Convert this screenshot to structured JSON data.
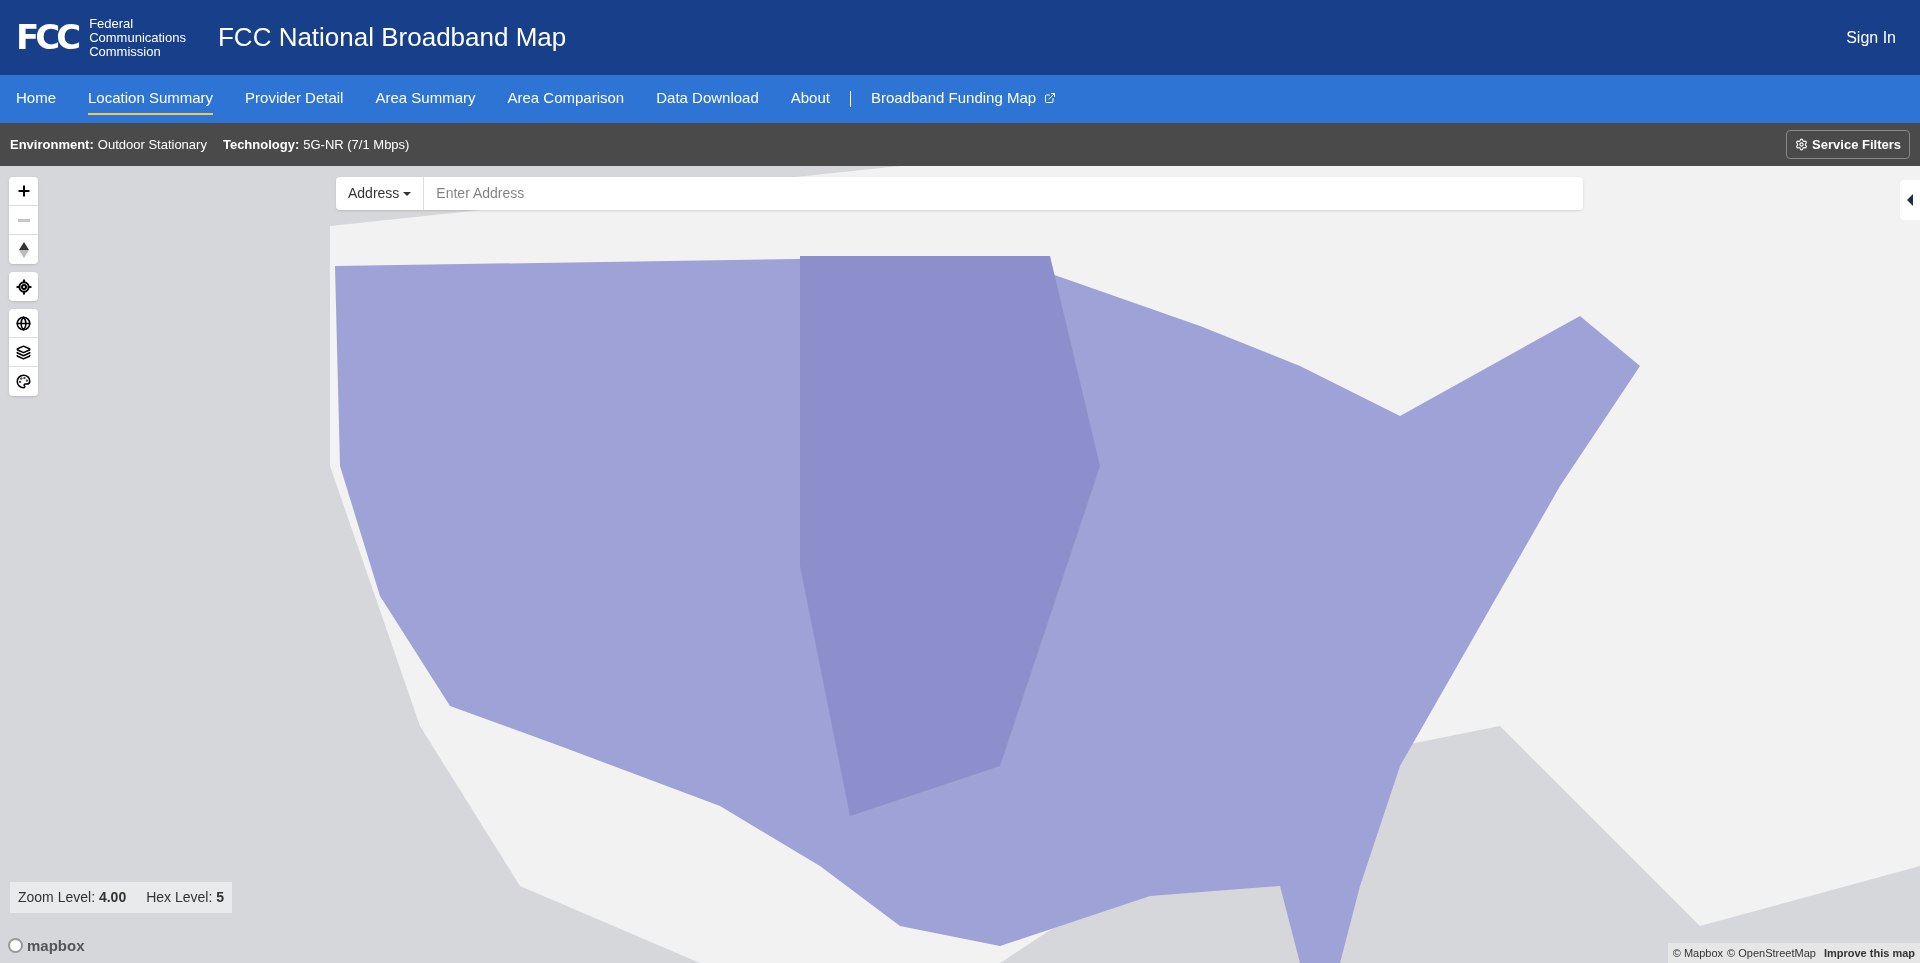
{
  "header": {
    "logo_mark": "FCC",
    "agency": [
      "Federal",
      "Communications",
      "Commission"
    ],
    "title": "FCC National Broadband Map",
    "sign_in": "Sign In"
  },
  "nav": [
    {
      "label": "Home",
      "selected": false
    },
    {
      "label": "Location Summary",
      "selected": true
    },
    {
      "label": "Provider Detail",
      "selected": false
    },
    {
      "label": "Area Summary",
      "selected": false
    },
    {
      "label": "Area Comparison",
      "selected": false
    },
    {
      "label": "Data Download",
      "selected": false
    },
    {
      "label": "About",
      "selected": false
    }
  ],
  "external_links": [
    {
      "label": "Broadband Funding Map"
    }
  ],
  "filters": [
    {
      "label": "Environment:",
      "value": "Outdoor Stationary"
    },
    {
      "label": "Technology:",
      "value": "5G-NR (7/1 Mbps)"
    }
  ],
  "service_filters": "Service Filters",
  "search": {
    "mode": "Address",
    "placeholder": "Enter Address"
  },
  "map_status": {
    "zoom_label": "Zoom Level:",
    "zoom_value": "4.00",
    "hex_label": "Hex Level:",
    "hex_value": "5"
  },
  "mapbox_logo": "mapbox",
  "attribution": [
    "© Mapbox",
    "© OpenStreetMap"
  ],
  "improve_link": "Improve this map"
}
